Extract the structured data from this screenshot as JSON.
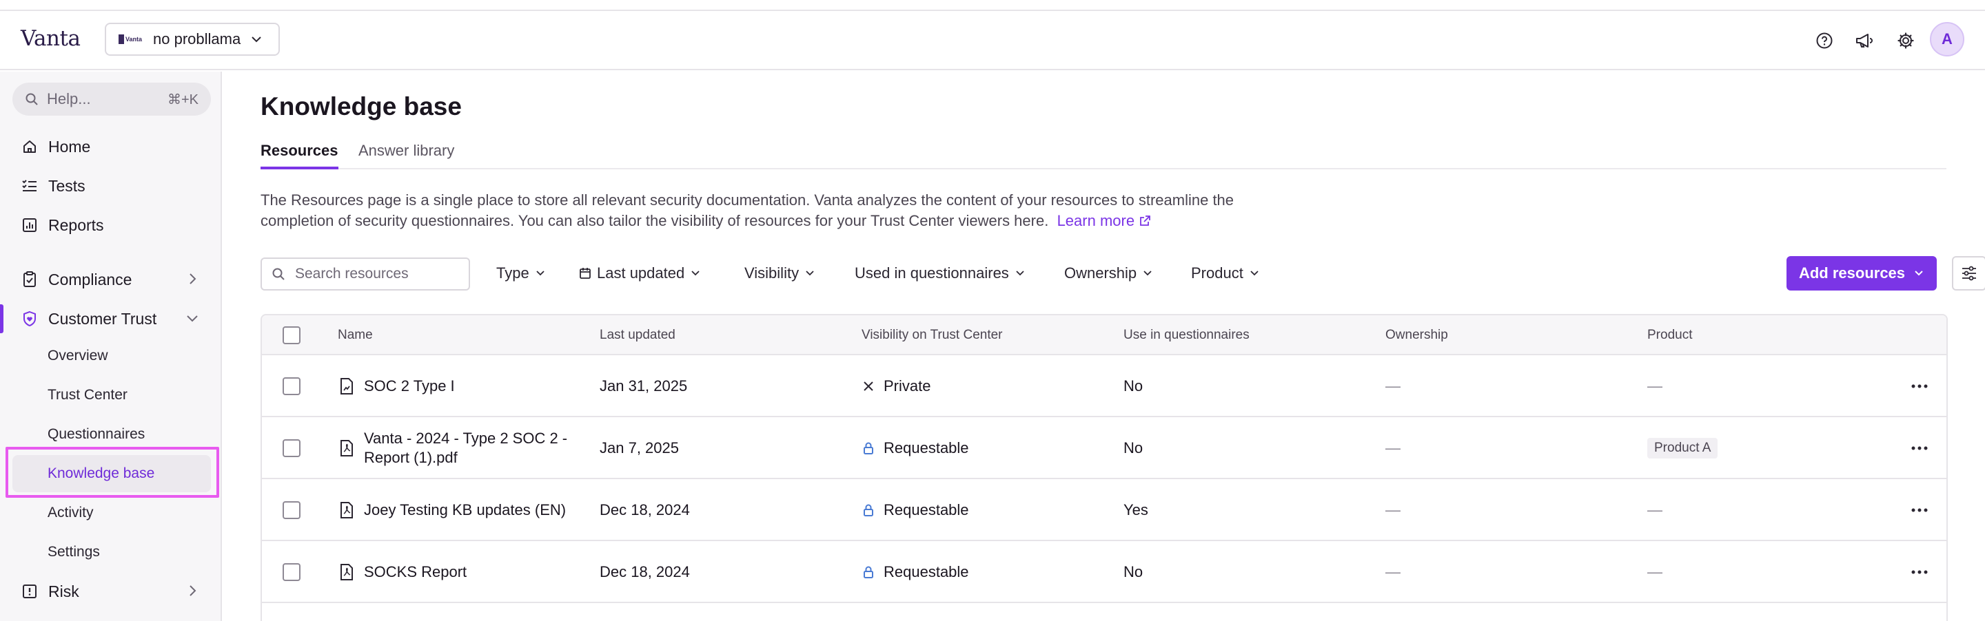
{
  "header": {
    "logo": "Vanta",
    "org_logo_text": "Vanta",
    "org_name": "no probllama",
    "avatar_initial": "A",
    "icons": [
      "help-circle-icon",
      "megaphone-icon",
      "gear-icon"
    ]
  },
  "sidebar": {
    "search_placeholder": "Help...",
    "search_shortcut": "⌘+K",
    "items": [
      {
        "label": "Home",
        "icon": "home-icon"
      },
      {
        "label": "Tests",
        "icon": "checklist-icon"
      },
      {
        "label": "Reports",
        "icon": "chart-icon"
      },
      {
        "label": "Compliance",
        "icon": "clipboard-icon"
      },
      {
        "label": "Customer Trust",
        "icon": "shield-heart-icon"
      },
      {
        "label": "Risk",
        "icon": "alert-square-icon"
      }
    ],
    "sub_items": [
      {
        "label": "Overview"
      },
      {
        "label": "Trust Center"
      },
      {
        "label": "Questionnaires"
      },
      {
        "label": "Knowledge base",
        "active": true
      },
      {
        "label": "Activity"
      },
      {
        "label": "Settings"
      }
    ]
  },
  "main": {
    "title": "Knowledge base",
    "tabs": [
      {
        "label": "Resources",
        "active": true
      },
      {
        "label": "Answer library",
        "active": false
      }
    ],
    "description_line1": "The Resources page is a single place to store all relevant security documentation. Vanta analyzes the content of your resources to streamline the",
    "description_line2": "completion of security questionnaires. You can also tailor the visibility of resources for your Trust Center viewers here.",
    "learn_more": "Learn more",
    "search_placeholder": "Search resources",
    "filters": [
      "Type",
      "Last updated",
      "Visibility",
      "Used in questionnaires",
      "Ownership",
      "Product"
    ],
    "add_button": "Add resources",
    "accent_color": "#7b35e6",
    "table": {
      "columns": [
        "Name",
        "Last updated",
        "Visibility on Trust Center",
        "Use in questionnaires",
        "Ownership",
        "Product"
      ],
      "rows": [
        {
          "name": "SOC 2 Type I",
          "updated": "Jan 31, 2025",
          "visibility": "Private",
          "visibility_icon": "x-icon",
          "questionnaires": "No",
          "ownership": "—",
          "product": "—"
        },
        {
          "name": "Vanta - 2024 - Type 2 SOC 2 - Report (1).pdf",
          "updated": "Jan 7, 2025",
          "visibility": "Requestable",
          "visibility_icon": "lock-icon",
          "questionnaires": "No",
          "ownership": "—",
          "product": "Product A"
        },
        {
          "name": "Joey Testing KB updates (EN)",
          "updated": "Dec 18, 2024",
          "visibility": "Requestable",
          "visibility_icon": "lock-icon",
          "questionnaires": "Yes",
          "ownership": "—",
          "product": "—"
        },
        {
          "name": "SOCKS Report",
          "updated": "Dec 18, 2024",
          "visibility": "Requestable",
          "visibility_icon": "lock-icon",
          "questionnaires": "No",
          "ownership": "—",
          "product": "—"
        }
      ]
    }
  }
}
